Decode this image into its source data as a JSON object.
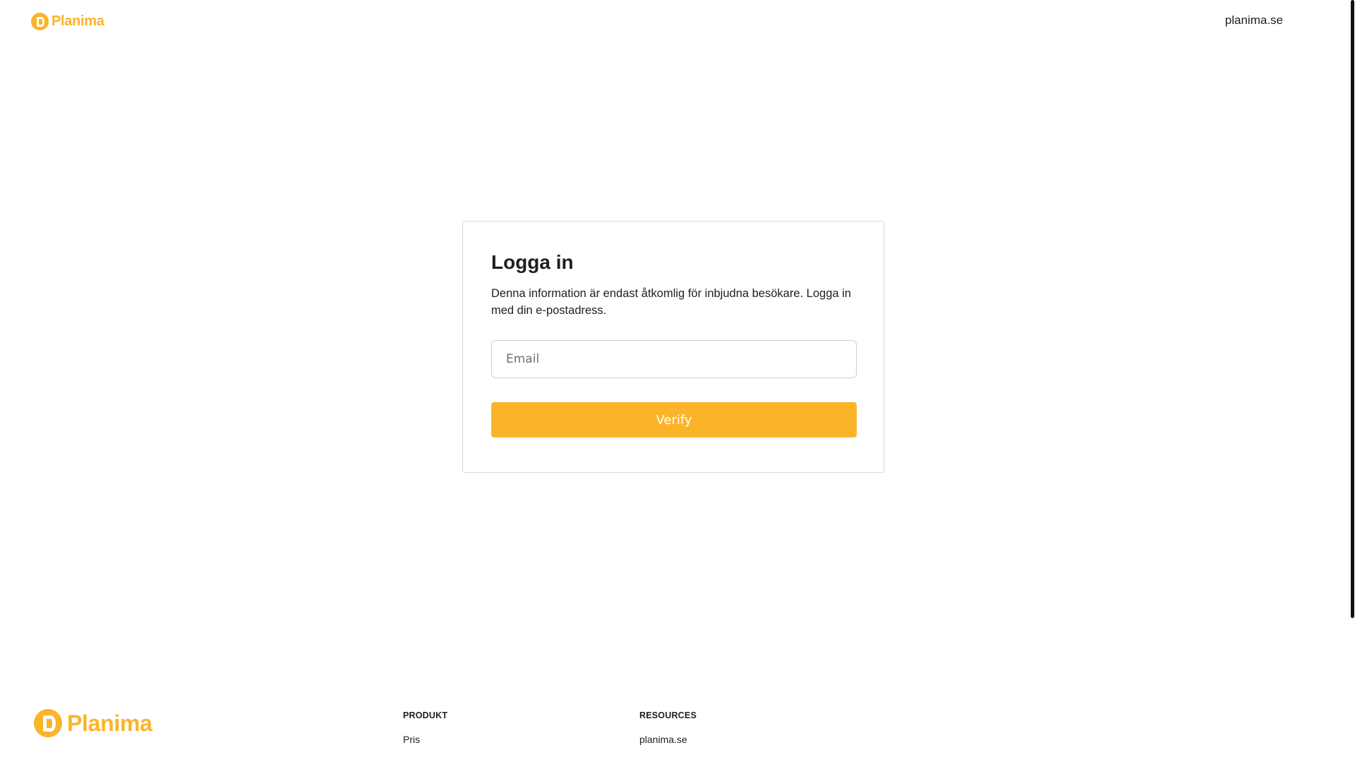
{
  "header": {
    "logo_text": "Planima",
    "link_label": "planima.se"
  },
  "login": {
    "title": "Logga in",
    "description": "Denna information är endast åtkomlig för inbjudna besökare. Logga in med din e-postadress.",
    "email_placeholder": "Email",
    "email_value": "",
    "verify_label": "Verify"
  },
  "footer": {
    "logo_text": "Planima",
    "columns": [
      {
        "heading": "PRODUKT",
        "links": [
          "Pris"
        ]
      },
      {
        "heading": "RESOURCES",
        "links": [
          "planima.se"
        ]
      }
    ]
  },
  "colors": {
    "brand": "#fbb42a",
    "text": "#1f1f1f",
    "border": "#d9d9d9"
  },
  "icons": {
    "logo": "planima-logo-icon"
  }
}
